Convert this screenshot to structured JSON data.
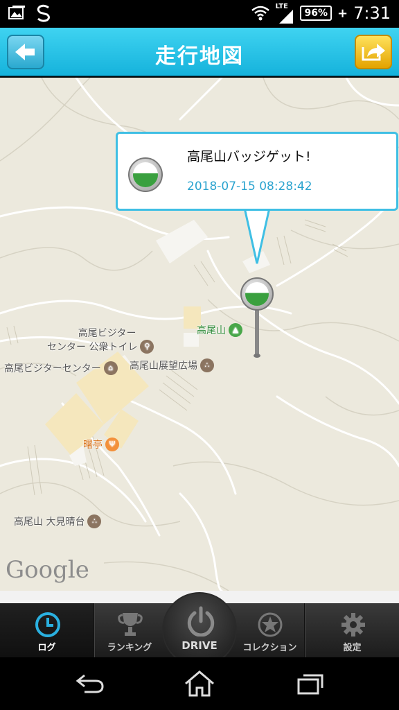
{
  "status_bar": {
    "network": "LTE",
    "battery": "96%",
    "time": "7:31"
  },
  "header": {
    "title": "走行地図"
  },
  "map": {
    "callout": {
      "title": "高尾山バッジゲット!",
      "timestamp": "2018-07-15 08:28:42"
    },
    "pois": [
      {
        "line1": "高尾ビジター",
        "line2": "センター 公衆トイレ"
      },
      {
        "line1": "高尾ビジターセンター"
      },
      {
        "line1": "高尾山展望広場"
      },
      {
        "line1": "高尾山"
      },
      {
        "line1": "曙亭"
      },
      {
        "line1": "高尾山 大見晴台"
      }
    ],
    "attribution": "Google"
  },
  "tabs": [
    {
      "label": "ログ",
      "icon": "clock-icon",
      "active": true
    },
    {
      "label": "ランキング",
      "icon": "trophy-icon"
    },
    {
      "label": "DRIVE",
      "icon": "power-icon"
    },
    {
      "label": "コレクション",
      "icon": "star-icon"
    },
    {
      "label": "設定",
      "icon": "gear-icon"
    }
  ],
  "colors": {
    "header": "#16b3dc",
    "callout_border": "#3fbfe4",
    "timestamp": "#2aa3cf",
    "map_bg": "#ece9dd"
  }
}
